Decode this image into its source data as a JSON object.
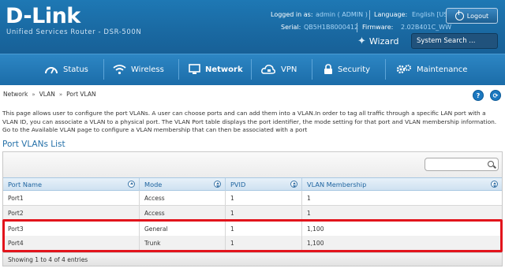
{
  "brand": {
    "logo": "D-Link",
    "subtitle": "Unified Services Router - DSR-500N"
  },
  "header": {
    "logged_in_label": "Logged in as:",
    "logged_in_value": "admin ( ADMIN )",
    "language_label": "Language:",
    "language_value": "English [US]",
    "serial_label": "Serial:",
    "serial_value": "QB5H1B8000412",
    "firmware_label": "Firmware:",
    "firmware_value": "2.02B401C_WW",
    "logout_label": "Logout",
    "wizard_label": "Wizard",
    "search_placeholder": "System Search ..."
  },
  "nav": {
    "items": [
      {
        "label": "Status",
        "icon": "gauge-icon"
      },
      {
        "label": "Wireless",
        "icon": "wifi-icon"
      },
      {
        "label": "Network",
        "icon": "monitor-icon",
        "active": true
      },
      {
        "label": "VPN",
        "icon": "cloud-lock-icon"
      },
      {
        "label": "Security",
        "icon": "padlock-icon"
      },
      {
        "label": "Maintenance",
        "icon": "gears-icon"
      }
    ]
  },
  "breadcrumb": [
    "Network",
    "VLAN",
    "Port VLAN"
  ],
  "breadcrumb_sep": "»",
  "help_labels": {
    "help": "?",
    "refresh": "⟳"
  },
  "description": "This page allows user to configure the port VLANs. A user can choose ports and can add them into a VLAN.In order to tag all traffic through a specific LAN port with a VLAN ID, you can associate a VLAN to a physical port. The VLAN Port table displays the port identifier, the mode setting for that port and VLAN membership information. Go to the Available VLAN page to configure a VLAN membership that can then be associated with a port",
  "section_title": "Port VLANs List",
  "table": {
    "columns": [
      "Port Name",
      "Mode",
      "PVID",
      "VLAN Membership"
    ],
    "rows": [
      {
        "port": "Port1",
        "mode": "Access",
        "pvid": "1",
        "membership": "1"
      },
      {
        "port": "Port2",
        "mode": "Access",
        "pvid": "1",
        "membership": "1"
      },
      {
        "port": "Port3",
        "mode": "General",
        "pvid": "1",
        "membership": "1,100"
      },
      {
        "port": "Port4",
        "mode": "Trunk",
        "pvid": "1",
        "membership": "1,100"
      }
    ],
    "footer": "Showing 1 to 4 of 4 entries"
  },
  "colors": {
    "accent": "#1b6ca8",
    "header_blue": "#1e78b4",
    "highlight": "#e2141c"
  }
}
